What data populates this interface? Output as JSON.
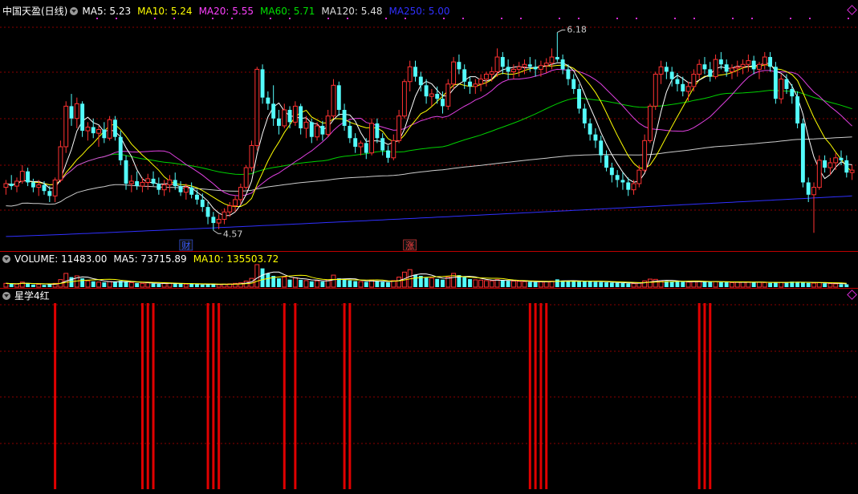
{
  "header": {
    "stock": "中国天盈(日线)",
    "ma_items": [
      {
        "label": "MA5: 5.23",
        "color": "#ffffff"
      },
      {
        "label": "MA10: 5.24",
        "color": "#ffff00"
      },
      {
        "label": "MA20: 5.55",
        "color": "#ff40ff"
      },
      {
        "label": "MA60: 5.71",
        "color": "#00e000"
      },
      {
        "label": "MA120: 5.48",
        "color": "#dddddd"
      },
      {
        "label": "MA250: 5.00",
        "color": "#3030ff"
      }
    ]
  },
  "volume_header": {
    "items": [
      {
        "label": "VOLUME: 11483.00",
        "color": "#ffffff"
      },
      {
        "label": "MA5: 73715.89",
        "color": "#ffffff"
      },
      {
        "label": "MA10: 135503.72",
        "color": "#ffff00"
      }
    ]
  },
  "indicator_header": {
    "label": "星学4红"
  },
  "colors": {
    "up": "#ff3232",
    "down": "#54fcfc",
    "grid": "#8b0000",
    "signal": "#e00000"
  },
  "chart_data": {
    "type": "candlestick",
    "price_annotations": [
      {
        "label": "6.18",
        "type": "high",
        "candle_index": 101
      },
      {
        "label": "4.57",
        "type": "low",
        "candle_index": 38
      }
    ],
    "event_markers": [
      {
        "label": "财",
        "candle_index": 33,
        "color": "#3a5cff"
      },
      {
        "label": "涨",
        "candle_index": 74,
        "color": "#ff4040"
      }
    ],
    "candles": [
      [
        4.92,
        4.98,
        4.86,
        4.95
      ],
      [
        4.95,
        5.02,
        4.9,
        4.93
      ],
      [
        4.93,
        5.0,
        4.88,
        4.97
      ],
      [
        4.97,
        5.1,
        4.95,
        5.05
      ],
      [
        5.05,
        5.08,
        4.93,
        4.96
      ],
      [
        4.96,
        4.99,
        4.88,
        4.92
      ],
      [
        4.92,
        4.98,
        4.85,
        4.94
      ],
      [
        4.94,
        4.97,
        4.86,
        4.89
      ],
      [
        4.89,
        4.93,
        4.8,
        4.85
      ],
      [
        4.85,
        5.0,
        4.8,
        4.98
      ],
      [
        4.98,
        5.3,
        4.96,
        5.25
      ],
      [
        5.25,
        5.62,
        5.2,
        5.58
      ],
      [
        5.58,
        5.68,
        5.42,
        5.48
      ],
      [
        5.48,
        5.65,
        5.4,
        5.6
      ],
      [
        5.6,
        5.62,
        5.33,
        5.38
      ],
      [
        5.38,
        5.45,
        5.3,
        5.41
      ],
      [
        5.41,
        5.48,
        5.32,
        5.36
      ],
      [
        5.36,
        5.42,
        5.25,
        5.39
      ],
      [
        5.39,
        5.45,
        5.28,
        5.32
      ],
      [
        5.32,
        5.5,
        5.3,
        5.47
      ],
      [
        5.47,
        5.5,
        5.3,
        5.33
      ],
      [
        5.33,
        5.38,
        5.1,
        5.14
      ],
      [
        5.14,
        5.18,
        4.9,
        4.95
      ],
      [
        4.95,
        5.02,
        4.88,
        4.97
      ],
      [
        4.97,
        5.05,
        4.9,
        4.93
      ],
      [
        4.93,
        5.0,
        4.88,
        4.96
      ],
      [
        4.96,
        5.03,
        4.9,
        4.99
      ],
      [
        4.99,
        5.05,
        4.93,
        4.95
      ],
      [
        4.95,
        5.0,
        4.86,
        4.9
      ],
      [
        4.9,
        4.98,
        4.85,
        4.94
      ],
      [
        4.94,
        5.02,
        4.88,
        4.98
      ],
      [
        4.98,
        5.04,
        4.9,
        4.93
      ],
      [
        4.93,
        4.97,
        4.85,
        4.88
      ],
      [
        4.88,
        4.95,
        4.82,
        4.92
      ],
      [
        4.92,
        4.96,
        4.83,
        4.86
      ],
      [
        4.86,
        4.9,
        4.78,
        4.82
      ],
      [
        4.82,
        4.87,
        4.72,
        4.76
      ],
      [
        4.76,
        4.8,
        4.62,
        4.68
      ],
      [
        4.68,
        4.72,
        4.57,
        4.63
      ],
      [
        4.63,
        4.7,
        4.58,
        4.66
      ],
      [
        4.66,
        4.75,
        4.62,
        4.72
      ],
      [
        4.72,
        4.8,
        4.68,
        4.77
      ],
      [
        4.77,
        4.85,
        4.72,
        4.82
      ],
      [
        4.82,
        4.95,
        4.78,
        4.92
      ],
      [
        4.92,
        5.1,
        4.9,
        5.08
      ],
      [
        5.08,
        5.3,
        5.05,
        5.26
      ],
      [
        5.26,
        5.9,
        5.22,
        5.88
      ],
      [
        5.88,
        5.92,
        5.6,
        5.65
      ],
      [
        5.65,
        5.7,
        5.55,
        5.6
      ],
      [
        5.6,
        5.75,
        5.42,
        5.48
      ],
      [
        5.48,
        5.55,
        5.35,
        5.42
      ],
      [
        5.42,
        5.6,
        5.4,
        5.55
      ],
      [
        5.55,
        5.58,
        5.4,
        5.45
      ],
      [
        5.45,
        5.62,
        5.42,
        5.58
      ],
      [
        5.58,
        5.6,
        5.35,
        5.4
      ],
      [
        5.4,
        5.5,
        5.32,
        5.45
      ],
      [
        5.45,
        5.48,
        5.28,
        5.33
      ],
      [
        5.33,
        5.45,
        5.3,
        5.42
      ],
      [
        5.42,
        5.46,
        5.3,
        5.35
      ],
      [
        5.35,
        5.55,
        5.33,
        5.5
      ],
      [
        5.5,
        5.8,
        5.48,
        5.75
      ],
      [
        5.75,
        5.78,
        5.5,
        5.55
      ],
      [
        5.55,
        5.6,
        5.38,
        5.42
      ],
      [
        5.42,
        5.46,
        5.28,
        5.32
      ],
      [
        5.32,
        5.36,
        5.2,
        5.25
      ],
      [
        5.25,
        5.3,
        5.18,
        5.28
      ],
      [
        5.28,
        5.32,
        5.15,
        5.2
      ],
      [
        5.2,
        5.48,
        5.18,
        5.44
      ],
      [
        5.44,
        5.48,
        5.28,
        5.32
      ],
      [
        5.32,
        5.36,
        5.18,
        5.22
      ],
      [
        5.22,
        5.26,
        5.12,
        5.16
      ],
      [
        5.16,
        5.35,
        5.14,
        5.3
      ],
      [
        5.3,
        5.55,
        5.28,
        5.5
      ],
      [
        5.5,
        5.8,
        5.48,
        5.78
      ],
      [
        5.78,
        5.95,
        5.7,
        5.9
      ],
      [
        5.9,
        5.95,
        5.78,
        5.82
      ],
      [
        5.82,
        5.86,
        5.7,
        5.75
      ],
      [
        5.75,
        5.8,
        5.6,
        5.66
      ],
      [
        5.66,
        5.72,
        5.58,
        5.68
      ],
      [
        5.68,
        5.74,
        5.6,
        5.64
      ],
      [
        5.64,
        5.7,
        5.52,
        5.58
      ],
      [
        5.58,
        5.8,
        5.55,
        5.76
      ],
      [
        5.76,
        5.98,
        5.72,
        5.94
      ],
      [
        5.94,
        6.0,
        5.84,
        5.88
      ],
      [
        5.88,
        5.92,
        5.72,
        5.78
      ],
      [
        5.78,
        5.82,
        5.68,
        5.74
      ],
      [
        5.74,
        5.8,
        5.68,
        5.76
      ],
      [
        5.76,
        5.84,
        5.7,
        5.8
      ],
      [
        5.8,
        5.86,
        5.74,
        5.84
      ],
      [
        5.84,
        5.9,
        5.78,
        5.86
      ],
      [
        5.86,
        6.05,
        5.82,
        5.98
      ],
      [
        5.98,
        6.02,
        5.84,
        5.9
      ],
      [
        5.9,
        5.96,
        5.8,
        5.86
      ],
      [
        5.86,
        5.92,
        5.8,
        5.88
      ],
      [
        5.88,
        5.94,
        5.82,
        5.9
      ],
      [
        5.9,
        5.96,
        5.84,
        5.92
      ],
      [
        5.92,
        5.98,
        5.86,
        5.9
      ],
      [
        5.9,
        5.96,
        5.82,
        5.88
      ],
      [
        5.88,
        5.95,
        5.82,
        5.91
      ],
      [
        5.91,
        5.97,
        5.85,
        5.93
      ],
      [
        5.93,
        6.05,
        5.88,
        5.98
      ],
      [
        5.98,
        6.18,
        5.94,
        5.96
      ],
      [
        5.96,
        6.0,
        5.84,
        5.88
      ],
      [
        5.88,
        5.92,
        5.75,
        5.8
      ],
      [
        5.8,
        5.84,
        5.68,
        5.72
      ],
      [
        5.72,
        5.76,
        5.52,
        5.56
      ],
      [
        5.56,
        5.6,
        5.4,
        5.44
      ],
      [
        5.44,
        5.48,
        5.3,
        5.35
      ],
      [
        5.35,
        5.4,
        5.24,
        5.3
      ],
      [
        5.3,
        5.34,
        5.12,
        5.18
      ],
      [
        5.18,
        5.22,
        5.05,
        5.08
      ],
      [
        5.08,
        5.12,
        4.96,
        5.02
      ],
      [
        5.02,
        5.06,
        4.92,
        4.98
      ],
      [
        4.98,
        5.04,
        4.9,
        4.96
      ],
      [
        4.96,
        5.0,
        4.85,
        4.9
      ],
      [
        4.9,
        4.98,
        4.86,
        4.95
      ],
      [
        4.95,
        5.1,
        4.92,
        5.06
      ],
      [
        5.06,
        5.35,
        5.04,
        5.3
      ],
      [
        5.3,
        5.6,
        5.28,
        5.58
      ],
      [
        5.58,
        5.86,
        5.55,
        5.84
      ],
      [
        5.84,
        5.95,
        5.76,
        5.9
      ],
      [
        5.9,
        5.94,
        5.8,
        5.86
      ],
      [
        5.86,
        5.9,
        5.74,
        5.8
      ],
      [
        5.8,
        5.85,
        5.7,
        5.76
      ],
      [
        5.76,
        5.82,
        5.66,
        5.7
      ],
      [
        5.7,
        5.78,
        5.62,
        5.74
      ],
      [
        5.74,
        5.88,
        5.7,
        5.84
      ],
      [
        5.84,
        5.96,
        5.8,
        5.92
      ],
      [
        5.92,
        5.98,
        5.84,
        5.88
      ],
      [
        5.88,
        5.94,
        5.78,
        5.82
      ],
      [
        5.82,
        6.0,
        5.8,
        5.96
      ],
      [
        5.96,
        6.02,
        5.88,
        5.92
      ],
      [
        5.92,
        5.96,
        5.82,
        5.86
      ],
      [
        5.86,
        5.92,
        5.8,
        5.89
      ],
      [
        5.89,
        5.95,
        5.82,
        5.9
      ],
      [
        5.9,
        5.96,
        5.84,
        5.92
      ],
      [
        5.92,
        6.0,
        5.86,
        5.95
      ],
      [
        5.95,
        5.99,
        5.84,
        5.88
      ],
      [
        5.88,
        5.94,
        5.8,
        5.92
      ],
      [
        5.92,
        6.02,
        5.88,
        5.98
      ],
      [
        5.98,
        6.02,
        5.86,
        5.9
      ],
      [
        5.9,
        5.94,
        5.6,
        5.64
      ],
      [
        5.64,
        5.84,
        5.6,
        5.8
      ],
      [
        5.8,
        5.84,
        5.68,
        5.72
      ],
      [
        5.72,
        5.76,
        5.6,
        5.66
      ],
      [
        5.66,
        5.7,
        5.4,
        5.44
      ],
      [
        5.44,
        5.48,
        4.92,
        4.96
      ],
      [
        4.96,
        5.0,
        4.8,
        4.86
      ],
      [
        4.86,
        4.96,
        4.55,
        4.92
      ],
      [
        4.92,
        5.18,
        4.9,
        5.14
      ],
      [
        5.14,
        5.18,
        5.04,
        5.08
      ],
      [
        5.08,
        5.16,
        5.02,
        5.12
      ],
      [
        5.12,
        5.2,
        5.06,
        5.16
      ],
      [
        5.16,
        5.22,
        5.1,
        5.14
      ],
      [
        5.14,
        5.18,
        5.0,
        5.04
      ],
      [
        5.04,
        5.1,
        4.98,
        5.06
      ]
    ],
    "volumes": [
      30,
      26,
      24,
      40,
      32,
      20,
      22,
      18,
      24,
      30,
      60,
      110,
      80,
      90,
      70,
      50,
      46,
      40,
      38,
      45,
      42,
      50,
      44,
      36,
      32,
      30,
      34,
      28,
      26,
      30,
      32,
      28,
      26,
      24,
      26,
      22,
      20,
      24,
      22,
      20,
      24,
      26,
      30,
      34,
      48,
      70,
      180,
      150,
      110,
      90,
      70,
      80,
      60,
      74,
      58,
      52,
      46,
      50,
      44,
      58,
      96,
      70,
      60,
      54,
      48,
      44,
      42,
      56,
      48,
      42,
      38,
      52,
      80,
      120,
      140,
      100,
      90,
      76,
      72,
      66,
      60,
      80,
      110,
      96,
      80,
      64,
      58,
      56,
      52,
      50,
      60,
      54,
      50,
      48,
      46,
      44,
      42,
      40,
      42,
      44,
      48,
      62,
      52,
      48,
      46,
      44,
      50,
      48,
      42,
      40,
      38,
      36,
      34,
      32,
      30,
      28,
      34,
      50,
      64,
      62,
      50,
      48,
      46,
      44,
      42,
      40,
      44,
      48,
      46,
      42,
      44,
      40,
      38,
      36,
      38,
      40,
      42,
      40,
      38,
      36,
      34,
      40,
      38,
      36,
      44,
      40,
      38,
      34,
      32,
      36,
      30,
      28,
      26,
      24,
      22
    ],
    "indicator_signals": [
      9,
      25,
      26,
      27,
      37,
      38,
      39,
      51,
      53,
      62,
      63,
      96,
      97,
      98,
      99,
      127,
      128,
      129
    ],
    "y_range": [
      4.5,
      6.3
    ]
  }
}
